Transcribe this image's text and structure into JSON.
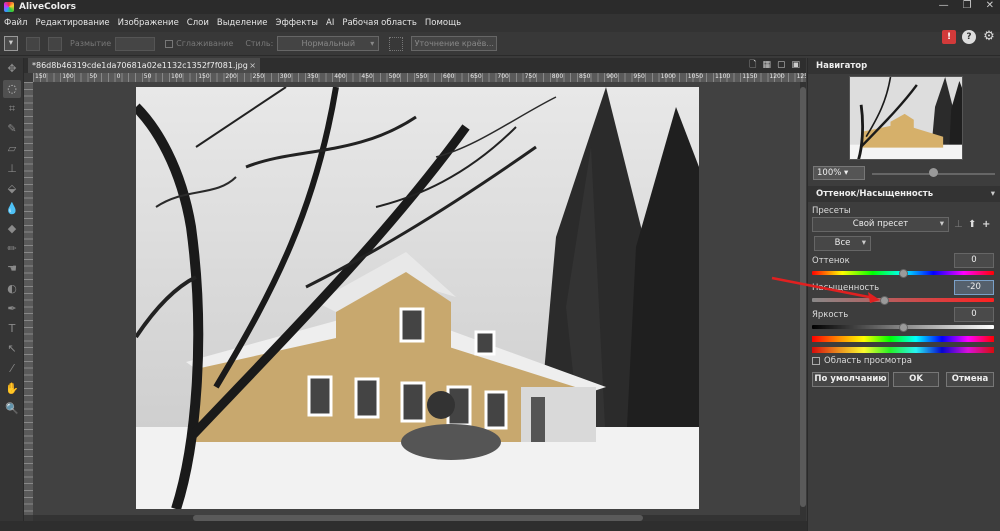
{
  "app": {
    "title": "AliveColors"
  },
  "window": {
    "minimize": "—",
    "maximize": "❐",
    "close": "✕"
  },
  "menu": [
    "Файл",
    "Редактирование",
    "Изображение",
    "Слои",
    "Выделение",
    "Эффекты",
    "AI",
    "Рабочая область",
    "Помощь"
  ],
  "options": {
    "blur_label": "Размытие",
    "blur_value": "",
    "smoothing_label": "Сглаживание",
    "style_label": "Стиль:",
    "style_value": "Нормальный",
    "refine_button": "Уточнение краёв..."
  },
  "document": {
    "tab_title": "*86d8b46319cde1da70681a02e1132c1352f7f081.jpg",
    "close": "×"
  },
  "ruler_ticks": [
    "150",
    "100",
    "50",
    "0",
    "50",
    "100",
    "150",
    "200",
    "250",
    "300",
    "350",
    "400",
    "450",
    "500",
    "550",
    "600",
    "650",
    "700",
    "750",
    "800",
    "850",
    "900",
    "950",
    "1000",
    "1050",
    "1100",
    "1150",
    "1200",
    "1250"
  ],
  "navigator": {
    "title": "Навигатор",
    "zoom": "100%"
  },
  "hue_sat": {
    "title": "Оттенок/Насыщенность",
    "presets_label": "Пресеты",
    "preset_value": "Свой пресет",
    "channel_value": "Все",
    "hue_label": "Оттенок",
    "hue_value": "0",
    "hue_level": 0,
    "saturation_label": "Насыщенность",
    "saturation_value": "-20",
    "saturation_level": -20,
    "brightness_label": "Яркость",
    "brightness_value": "0",
    "brightness_level": 0,
    "preview_area_label": "Область просмотра",
    "default_button": "По умолчанию",
    "ok_button": "OK",
    "cancel_button": "Отмена"
  },
  "colors": {
    "accent_arrow": "#e02020",
    "foreground": "#ffffff",
    "background": "#000000"
  }
}
